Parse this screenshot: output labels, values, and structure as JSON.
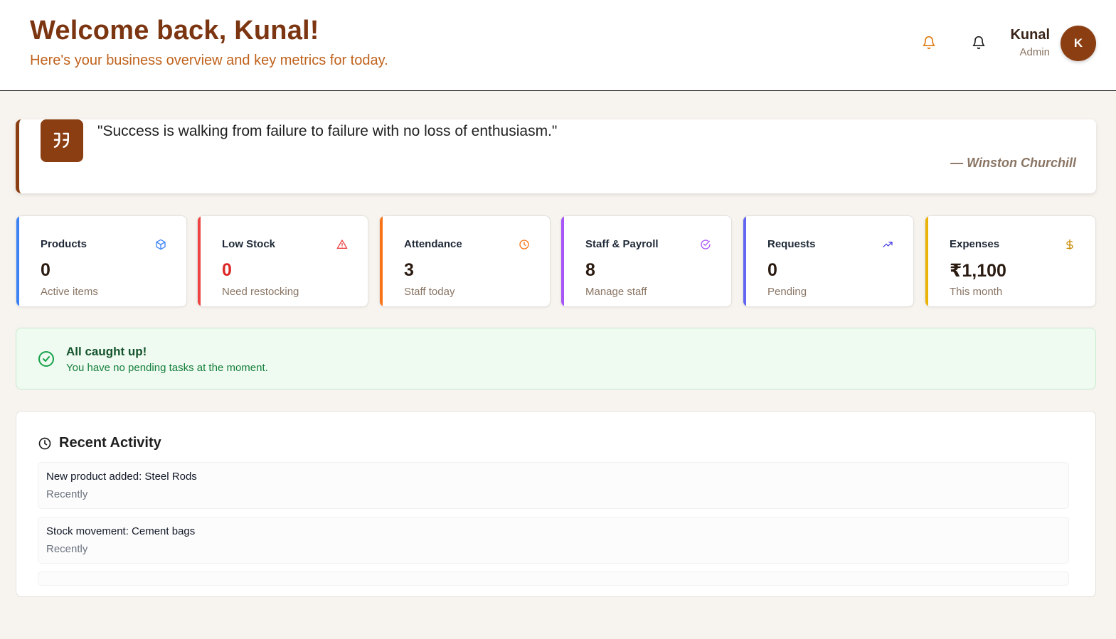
{
  "header": {
    "title": "Welcome back, Kunal!",
    "subtitle": "Here's your business overview and key metrics for today.",
    "user_name": "Kunal",
    "user_role": "Admin",
    "avatar_initial": "K",
    "icons": [
      "bell-icon",
      "bell-icon"
    ]
  },
  "quote": {
    "text": "\"Success is walking from failure to failure with no loss of enthusiasm.\"",
    "author": "— Winston Churchill",
    "icon": "quote-icon"
  },
  "stats": [
    {
      "label": "Products",
      "value": "0",
      "sub": "Active items",
      "color": "#3b82f6",
      "icon": "box-icon"
    },
    {
      "label": "Low Stock",
      "value": "0",
      "sub": "Need restocking",
      "color": "#ef4444",
      "icon": "warning-icon"
    },
    {
      "label": "Attendance",
      "value": "3",
      "sub": "Staff today",
      "color": "#f97316",
      "icon": "clock-icon"
    },
    {
      "label": "Staff & Payroll",
      "value": "8",
      "sub": "Manage staff",
      "color": "#a855f7",
      "icon": "check-circle-icon"
    },
    {
      "label": "Requests",
      "value": "0",
      "sub": "Pending",
      "color": "#6366f1",
      "icon": "trending-up-icon"
    },
    {
      "label": "Expenses",
      "value": "₹1,100",
      "sub": "This month",
      "color": "#eab308",
      "icon": "dollar-icon"
    }
  ],
  "caught_up": {
    "title": "All caught up!",
    "subtitle": "You have no pending tasks at the moment."
  },
  "activity": {
    "title": "Recent Activity",
    "items": [
      {
        "text": "New product added: Steel Rods",
        "time": "Recently"
      },
      {
        "text": "Stock movement: Cement bags",
        "time": "Recently"
      }
    ]
  },
  "colors": {
    "brand": "#8b3e12",
    "title": "#7c3511",
    "subtitle": "#c0621c",
    "background": "#f7f3ee"
  }
}
